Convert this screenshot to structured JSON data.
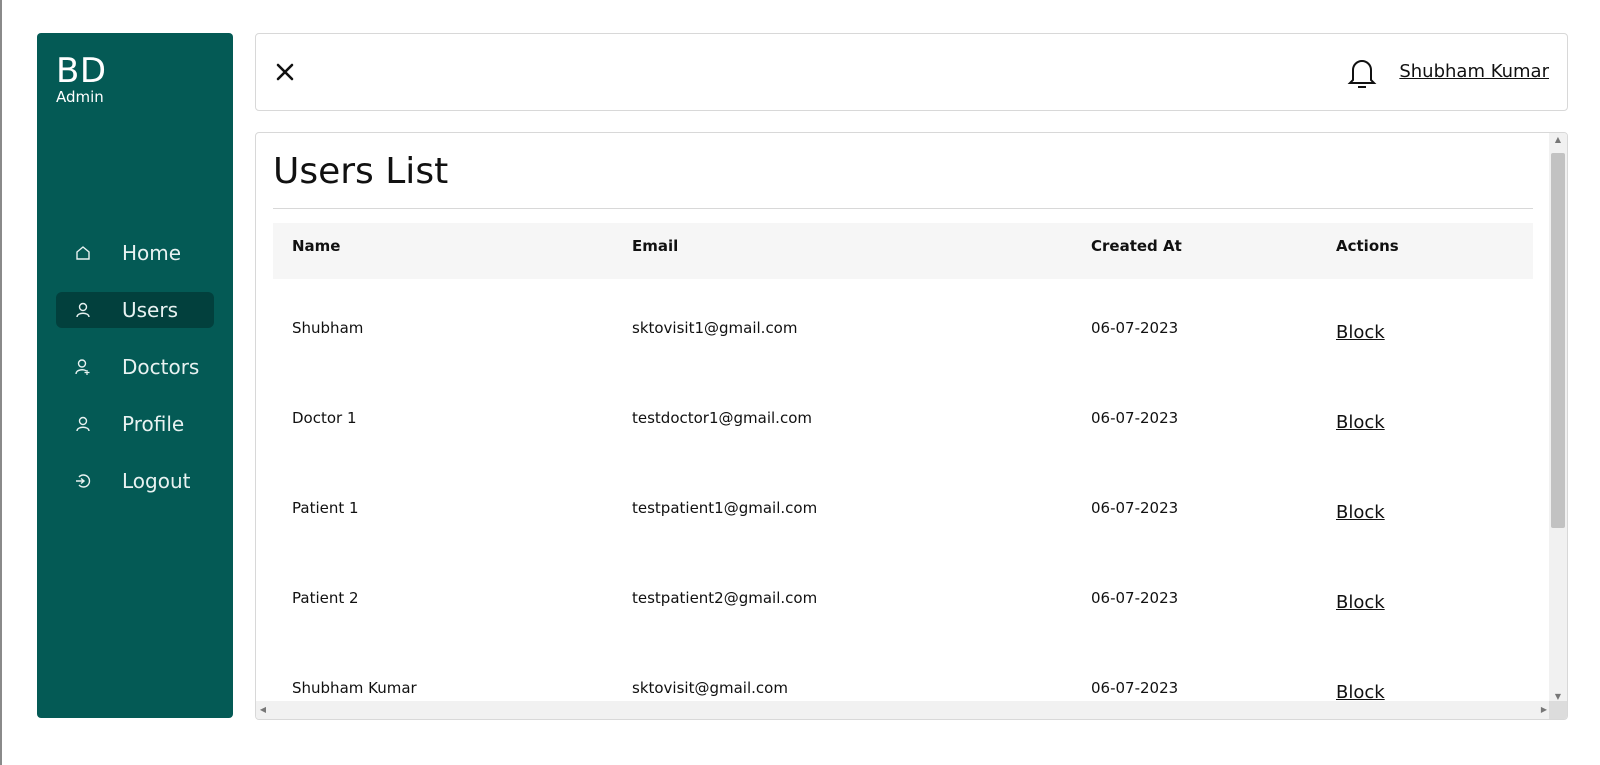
{
  "sidebar": {
    "brand_title": "BD",
    "brand_sub": "Admin",
    "items": [
      {
        "label": "Home",
        "icon": "home-icon",
        "active": false
      },
      {
        "label": "Users",
        "icon": "user-icon",
        "active": true
      },
      {
        "label": "Doctors",
        "icon": "doctor-icon",
        "active": false
      },
      {
        "label": "Profile",
        "icon": "user-icon",
        "active": false
      },
      {
        "label": "Logout",
        "icon": "logout-icon",
        "active": false
      }
    ]
  },
  "header": {
    "close_icon": "close-icon",
    "bell_icon": "bell-icon",
    "user_name": "Shubham Kumar"
  },
  "main": {
    "title": "Users List",
    "columns": [
      "Name",
      "Email",
      "Created At",
      "Actions"
    ],
    "rows": [
      {
        "name": "Shubham",
        "email": "sktovisit1@gmail.com",
        "created_at": "06-07-2023",
        "action": "Block"
      },
      {
        "name": "Doctor 1",
        "email": "testdoctor1@gmail.com",
        "created_at": "06-07-2023",
        "action": "Block"
      },
      {
        "name": "Patient 1",
        "email": "testpatient1@gmail.com",
        "created_at": "06-07-2023",
        "action": "Block"
      },
      {
        "name": "Patient 2",
        "email": "testpatient2@gmail.com",
        "created_at": "06-07-2023",
        "action": "Block"
      },
      {
        "name": "Shubham Kumar",
        "email": "sktovisit@gmail.com",
        "created_at": "06-07-2023",
        "action": "Block"
      }
    ]
  },
  "colors": {
    "sidebar_bg": "#045a55",
    "sidebar_active": "#02403d"
  }
}
